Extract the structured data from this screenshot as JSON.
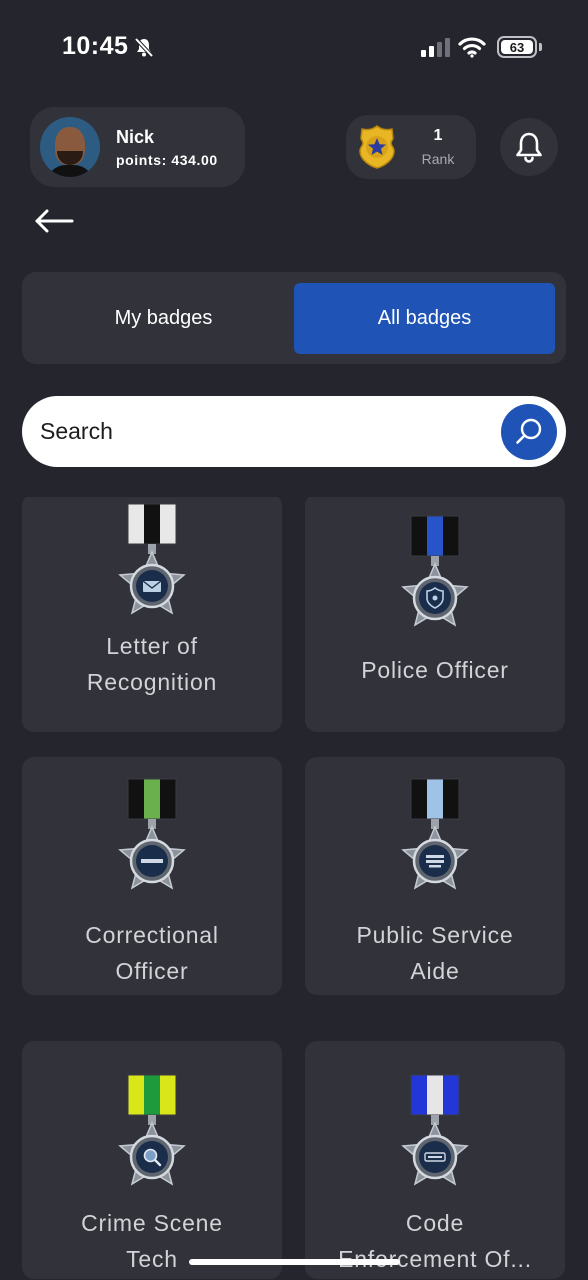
{
  "status_bar": {
    "time": "10:45",
    "battery": "63",
    "icons": [
      "bell-slash-icon",
      "cellular-signal-icon",
      "wifi-icon",
      "battery-icon"
    ]
  },
  "header": {
    "user_name": "Nick",
    "points": "points: 434.00",
    "rank_value": "1",
    "rank_label": "Rank",
    "icons": [
      "avatar",
      "police-shield-icon",
      "bell-icon",
      "back-arrow-icon"
    ]
  },
  "tabs": [
    {
      "label": "My badges",
      "active": false
    },
    {
      "label": "All badges",
      "active": true
    }
  ],
  "search": {
    "placeholder": "Search",
    "icon": "search-icon"
  },
  "badges": [
    {
      "name": "Letter of\nRecognition",
      "ribbon": [
        "#e8e8e8",
        "#111111",
        "#e8e8e8"
      ],
      "emblem": "letter"
    },
    {
      "name": "Police Officer",
      "ribbon": [
        "#111111",
        "#2754c8",
        "#111111"
      ],
      "emblem": "shield"
    },
    {
      "name": "Correctional\nOfficer",
      "ribbon": [
        "#111111",
        "#6ab04c",
        "#111111"
      ],
      "emblem": "correctional"
    },
    {
      "name": "Public Service\nAide",
      "ribbon": [
        "#111111",
        "#9ec3e6",
        "#111111"
      ],
      "emblem": "public-service"
    },
    {
      "name": "Crime Scene\nTech",
      "ribbon": [
        "#d8e61a",
        "#1e9a3c",
        "#d8e61a"
      ],
      "emblem": "magnifier"
    },
    {
      "name": "Code\nEnforcement Of...",
      "ribbon": [
        "#2336d8",
        "#e6e6e6",
        "#2336d8"
      ],
      "emblem": "code"
    }
  ],
  "colors": {
    "background": "#25262d",
    "card": "#31323a",
    "accent": "#1f53b5"
  }
}
